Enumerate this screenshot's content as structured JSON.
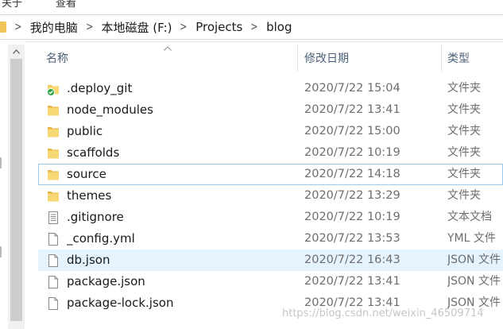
{
  "ribbon": {
    "item1": "关于",
    "item2": "查看"
  },
  "address": {
    "crumbs": [
      "我的电脑",
      "本地磁盘 (F:)",
      "Projects",
      "blog"
    ]
  },
  "columns": {
    "name": "名称",
    "date": "修改日期",
    "type": "类型"
  },
  "files": [
    {
      "name": ".deploy_git",
      "date": "2020/7/22 15:04",
      "type": "文件夹",
      "icon": "folder-synced-icon"
    },
    {
      "name": "node_modules",
      "date": "2020/7/22 13:41",
      "type": "文件夹",
      "icon": "folder-icon"
    },
    {
      "name": "public",
      "date": "2020/7/22 15:00",
      "type": "文件夹",
      "icon": "folder-icon"
    },
    {
      "name": "scaffolds",
      "date": "2020/7/22 10:19",
      "type": "文件夹",
      "icon": "folder-icon"
    },
    {
      "name": "source",
      "date": "2020/7/22 14:18",
      "type": "文件夹",
      "icon": "folder-icon"
    },
    {
      "name": "themes",
      "date": "2020/7/22 13:29",
      "type": "文件夹",
      "icon": "folder-icon"
    },
    {
      "name": ".gitignore",
      "date": "2020/7/22 10:19",
      "type": "文本文档",
      "icon": "text-document-icon"
    },
    {
      "name": "_config.yml",
      "date": "2020/7/22 13:53",
      "type": "YML 文件",
      "icon": "file-icon"
    },
    {
      "name": "db.json",
      "date": "2020/7/22 16:43",
      "type": "JSON 文件",
      "icon": "file-icon"
    },
    {
      "name": "package.json",
      "date": "2020/7/22 13:41",
      "type": "JSON 文件",
      "icon": "file-icon"
    },
    {
      "name": "package-lock.json",
      "date": "2020/7/22 13:41",
      "type": "JSON 文件",
      "icon": "file-icon"
    }
  ],
  "watermark": "https://blog.csdn.net/weixin_46509714",
  "colors": {
    "folder": "#f2c55a",
    "sync_badge": "#2aa33b",
    "hover_row": "#e5f3ff",
    "selected_border": "#99c9ef",
    "header_text": "#4c607a"
  }
}
